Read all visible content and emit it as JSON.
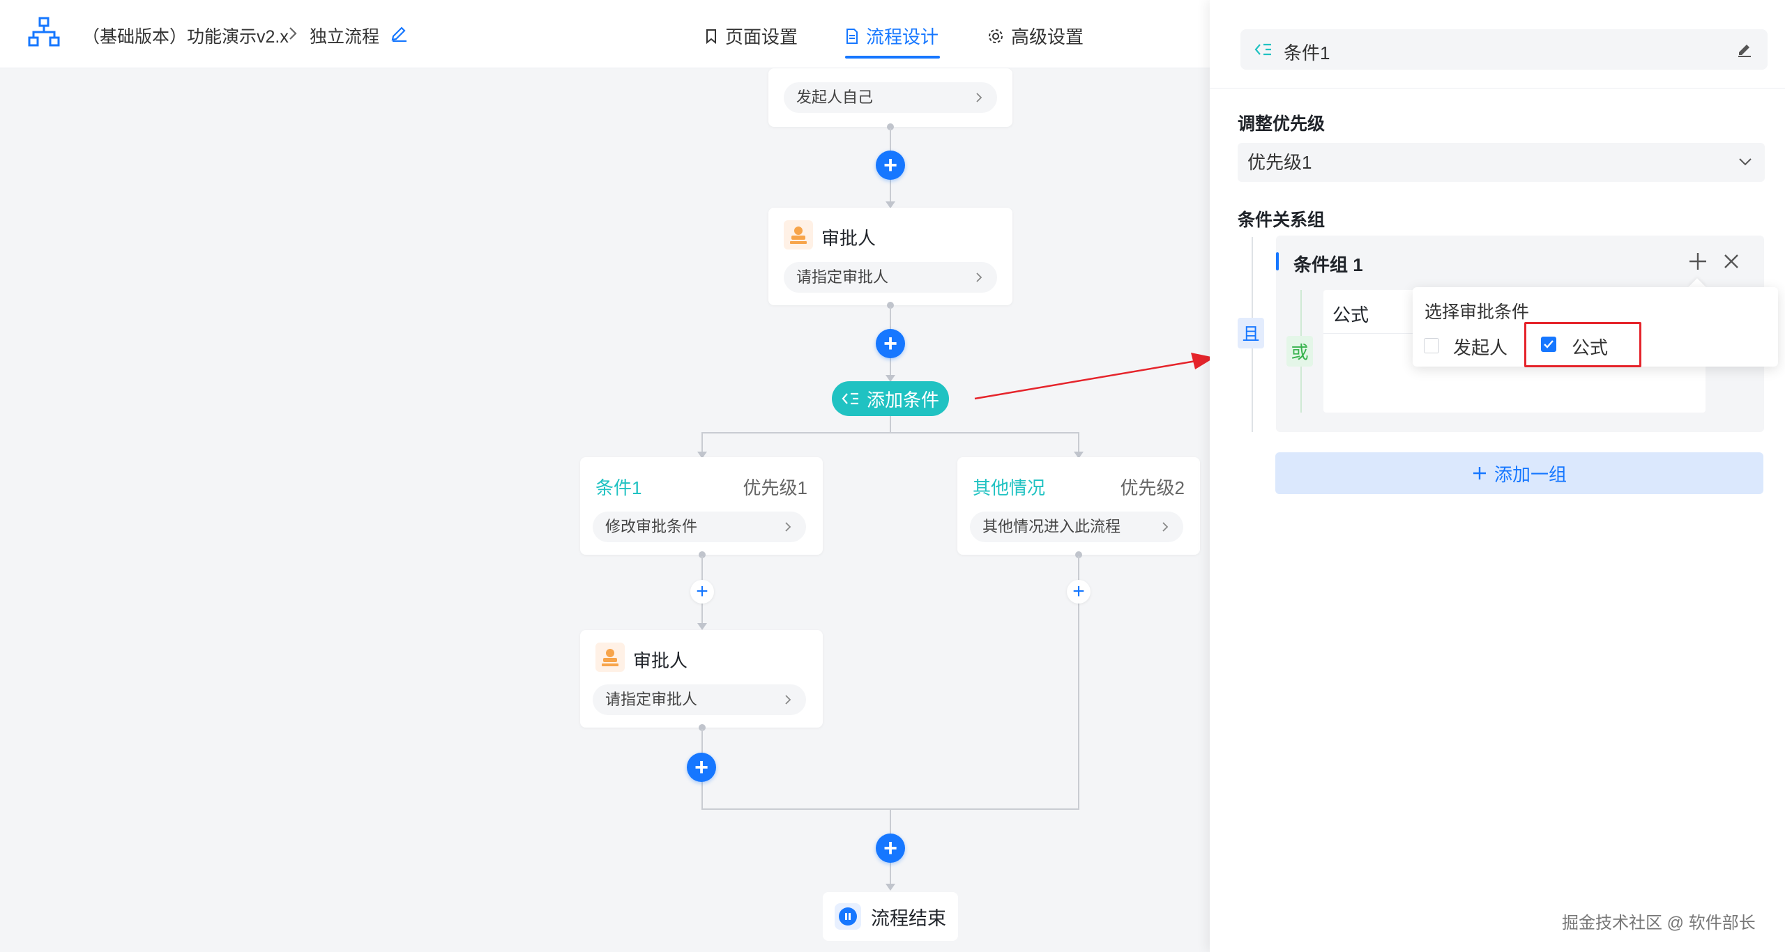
{
  "header": {
    "breadcrumb_app": "（基础版本）功能演示v2.x",
    "breadcrumb_flow": "独立流程",
    "tabs": [
      {
        "label": "页面设置",
        "icon": "bookmark-icon"
      },
      {
        "label": "流程设计",
        "icon": "document-icon",
        "active": true
      },
      {
        "label": "高级设置",
        "icon": "gear-icon"
      }
    ]
  },
  "canvas": {
    "initiator_card": {
      "body": "发起人自己"
    },
    "approver_card": {
      "title": "审批人",
      "body": "请指定审批人"
    },
    "add_condition_label": "添加条件",
    "branches": [
      {
        "title": "条件1",
        "priority": "优先级1",
        "body": "修改审批条件"
      },
      {
        "title": "其他情况",
        "priority": "优先级2",
        "body": "其他情况进入此流程"
      }
    ],
    "branch_approver": {
      "title": "审批人",
      "body": "请指定审批人"
    },
    "end_label": "流程结束"
  },
  "panel": {
    "title": "条件1",
    "priority_section_label": "调整优先级",
    "priority_value": "优先级1",
    "group_section_label": "条件关系组",
    "group_title": "条件组 1",
    "and_label": "且",
    "or_label": "或",
    "formula_label": "公式",
    "popover": {
      "title": "选择审批条件",
      "options": [
        {
          "label": "发起人",
          "checked": false
        },
        {
          "label": "公式",
          "checked": true
        }
      ]
    },
    "add_group_label": "添加一组"
  },
  "watermark": "掘金技术社区 @ 软件部长",
  "colors": {
    "primary": "#1677ff",
    "teal": "#20c2c2",
    "highlight_red": "#e5242b"
  }
}
